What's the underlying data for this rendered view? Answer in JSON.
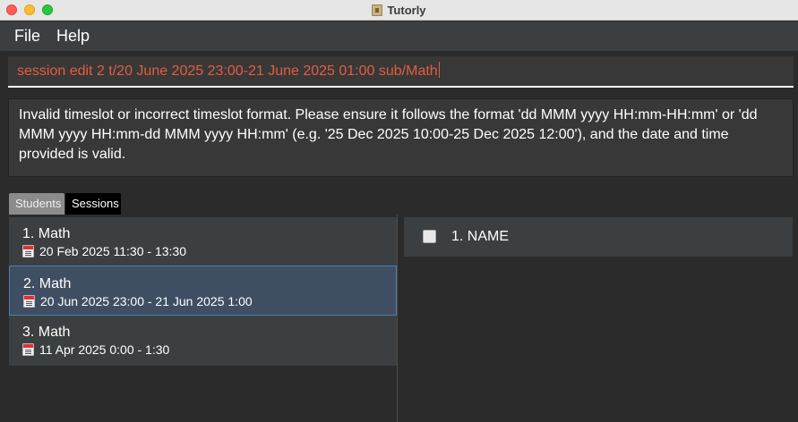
{
  "window": {
    "title": "Tutorly"
  },
  "menu": {
    "file": "File",
    "help": "Help"
  },
  "command": {
    "value": "session edit 2 t/20 June 2025 23:00-21 June 2025 01:00 sub/Math"
  },
  "result": {
    "message": "Invalid timeslot or incorrect timeslot format. Please ensure it follows the format 'dd MMM yyyy HH:mm-HH:mm' or 'dd MMM yyyy HH:mm-dd MMM yyyy HH:mm' (e.g. '25 Dec 2025 10:00-25 Dec 2025 12:00'), and the date and time provided is valid."
  },
  "tabs": [
    {
      "label": "Students",
      "selected": false
    },
    {
      "label": "Sessions",
      "selected": true
    }
  ],
  "sessions": [
    {
      "title": "1. Math",
      "time": "20 Feb 2025 11:30 - 13:30",
      "icon": "calendar-icon"
    },
    {
      "title": "2. Math",
      "time": "20 Jun 2025 23:00 - 21 Jun 2025 1:00",
      "icon": "calendar-icon",
      "selected": true
    },
    {
      "title": "3. Math",
      "time": "11 Apr 2025 0:00 - 1:30",
      "icon": "calendar-icon"
    }
  ],
  "attendance": [
    {
      "label": "1. NAME",
      "checked": false
    }
  ],
  "colors": {
    "background": "#2b2b2b",
    "command_text": "#e65c3e",
    "selected_card": "#3f4e63"
  }
}
